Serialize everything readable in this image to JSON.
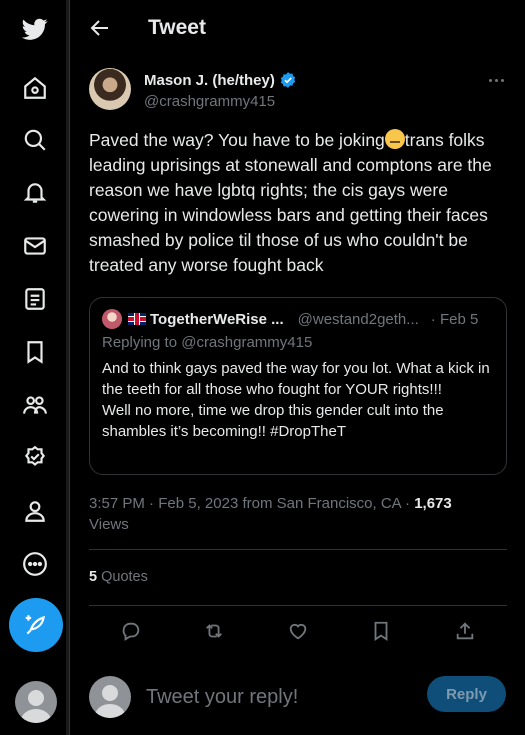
{
  "nav": {
    "items": [
      "twitter-logo",
      "home",
      "explore",
      "notifications",
      "messages",
      "lists",
      "bookmarks",
      "communities",
      "verified",
      "profile",
      "more"
    ],
    "compose_icon": "feather-plus-icon"
  },
  "header": {
    "title": "Tweet"
  },
  "tweet": {
    "author_name": "Mason J. (he/they)",
    "author_handle": "@crashgrammy415",
    "text_before_emoji": "Paved the way? You have to be joking",
    "text_after_emoji": "trans folks leading uprisings at stonewall and comptons are the reason we have lgbtq rights; the cis gays were cowering in windowless bars and getting their faces smashed by police til those of us who couldn't be treated any worse fought back",
    "emoji": "face-with-rolling-eyes"
  },
  "quote": {
    "name": "TogetherWeRise ...",
    "handle": "@westand2geth...",
    "date": "· Feb 5",
    "replying_to": "Replying to @crashgrammy415",
    "body_line_1": "And to think gays paved the way for you lot. What a kick in the teeth for all those who fought for YOUR rights!!!",
    "body_line_2": "Well no more, time we drop this gender cult into the shambles it’s becoming!! #DropTheT"
  },
  "meta": {
    "time": "3:57 PM",
    "dot1": " · ",
    "date": "Feb 5, 2023 from San Francisco, CA",
    "dot2": " · ",
    "views_count": "1,673",
    "views_label": "Views"
  },
  "stats": {
    "quotes_count": "5",
    "quotes_label": "Quotes"
  },
  "reply": {
    "placeholder": "Tweet your reply!",
    "button_label": "Reply"
  },
  "colors": {
    "accent": "#1d9bf0",
    "background": "#000000",
    "border": "#2f3336",
    "muted": "#71767b"
  }
}
